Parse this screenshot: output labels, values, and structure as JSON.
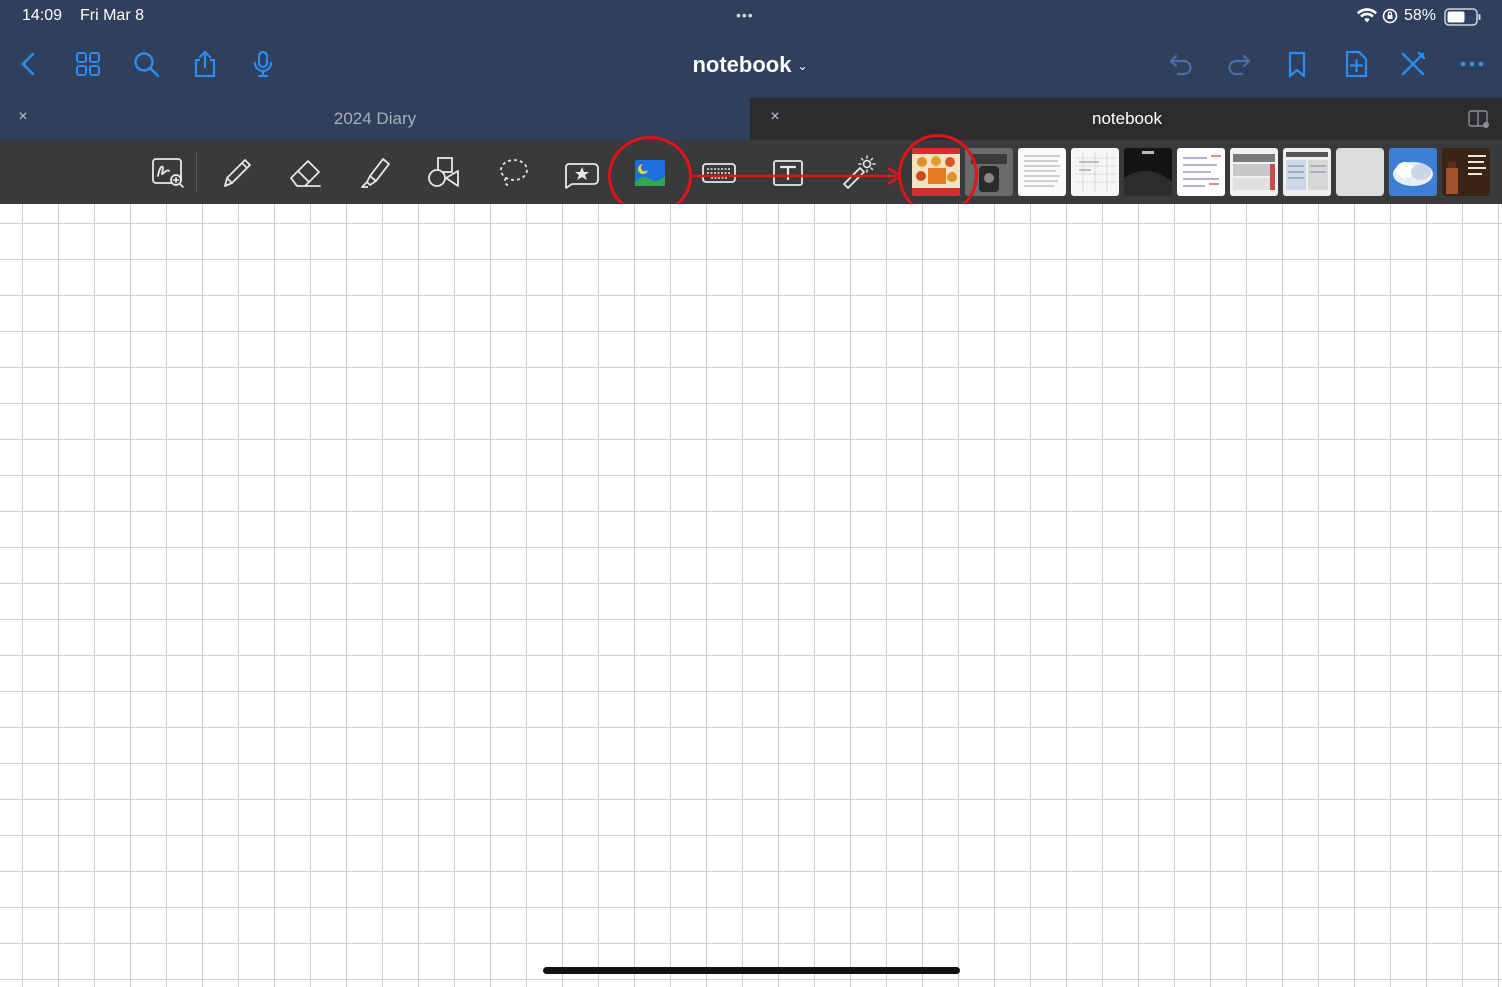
{
  "status_bar": {
    "time": "14:09",
    "date": "Fri Mar 8",
    "battery": "58%",
    "dots": "•••"
  },
  "nav": {
    "title": "notebook",
    "title_chevron": "⌄",
    "accent_color": "#2d8cf0"
  },
  "tabs": [
    {
      "label": "2024 Diary",
      "close": "×"
    },
    {
      "label": "notebook",
      "close": "×"
    }
  ],
  "toolbar": {
    "tools": [
      "zoom-window-icon",
      "pen-icon",
      "eraser-icon",
      "highlighter-icon",
      "shapes-icon",
      "lasso-icon",
      "sticker-icon",
      "image-icon",
      "keyboard-icon",
      "text-box-icon",
      "laser-pointer-icon"
    ],
    "selected_tool": "image-icon",
    "recent_images_count_shown": 11
  },
  "annotations": {
    "color": "#e0141a"
  }
}
